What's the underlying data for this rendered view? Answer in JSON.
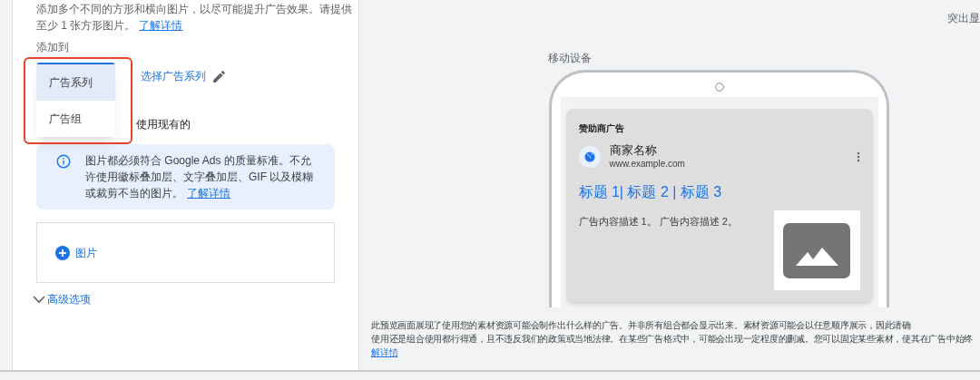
{
  "left_panel": {
    "intro_lines": [
      "添加多个不同的方形和横向图片，以尽可能提升广告效果。请提供",
      "至少 1 张方形图片。"
    ],
    "intro_link": "了解详情",
    "add_to_label": "添加到",
    "dropdown_options": [
      {
        "label": "广告系列",
        "selected": true
      },
      {
        "label": "广告组",
        "selected": false
      }
    ],
    "select_link": "选择广告系列",
    "existing_label": "使用现有的",
    "info": {
      "text": "图片都必须符合 Google Ads 的质量标准。不允许使用徽标叠加层、文字叠加层、GIF 以及模糊或裁剪不当的图片。",
      "link": "了解详情"
    },
    "add_image_button": "图片",
    "advanced_options": "高级选项"
  },
  "preview": {
    "highlight_label": "突出显",
    "device_label": "移动设备",
    "ad": {
      "sponsor_label": "赞助商广告",
      "business_name": "商家名称",
      "url": "www.example.com",
      "headline": "标题 1| 标题 2 | 标题 3",
      "description": "广告内容描述 1。 广告内容描述 2。"
    },
    "disclaimer_lines": [
      "此预览画面展现了使用您的素材资源可能会制作出什么样的广告。并非所有组合都会显示出来。素材资源可能会以任意顺序展示，因此请确",
      "使用还是组合使用都行得通，且不违反我们的政策或当地法律。在某些广告格式中，可能会出现一定程度的删减。您可以固定某些素材，使其在广告中始终"
    ],
    "disclaimer_link": "解详情"
  }
}
